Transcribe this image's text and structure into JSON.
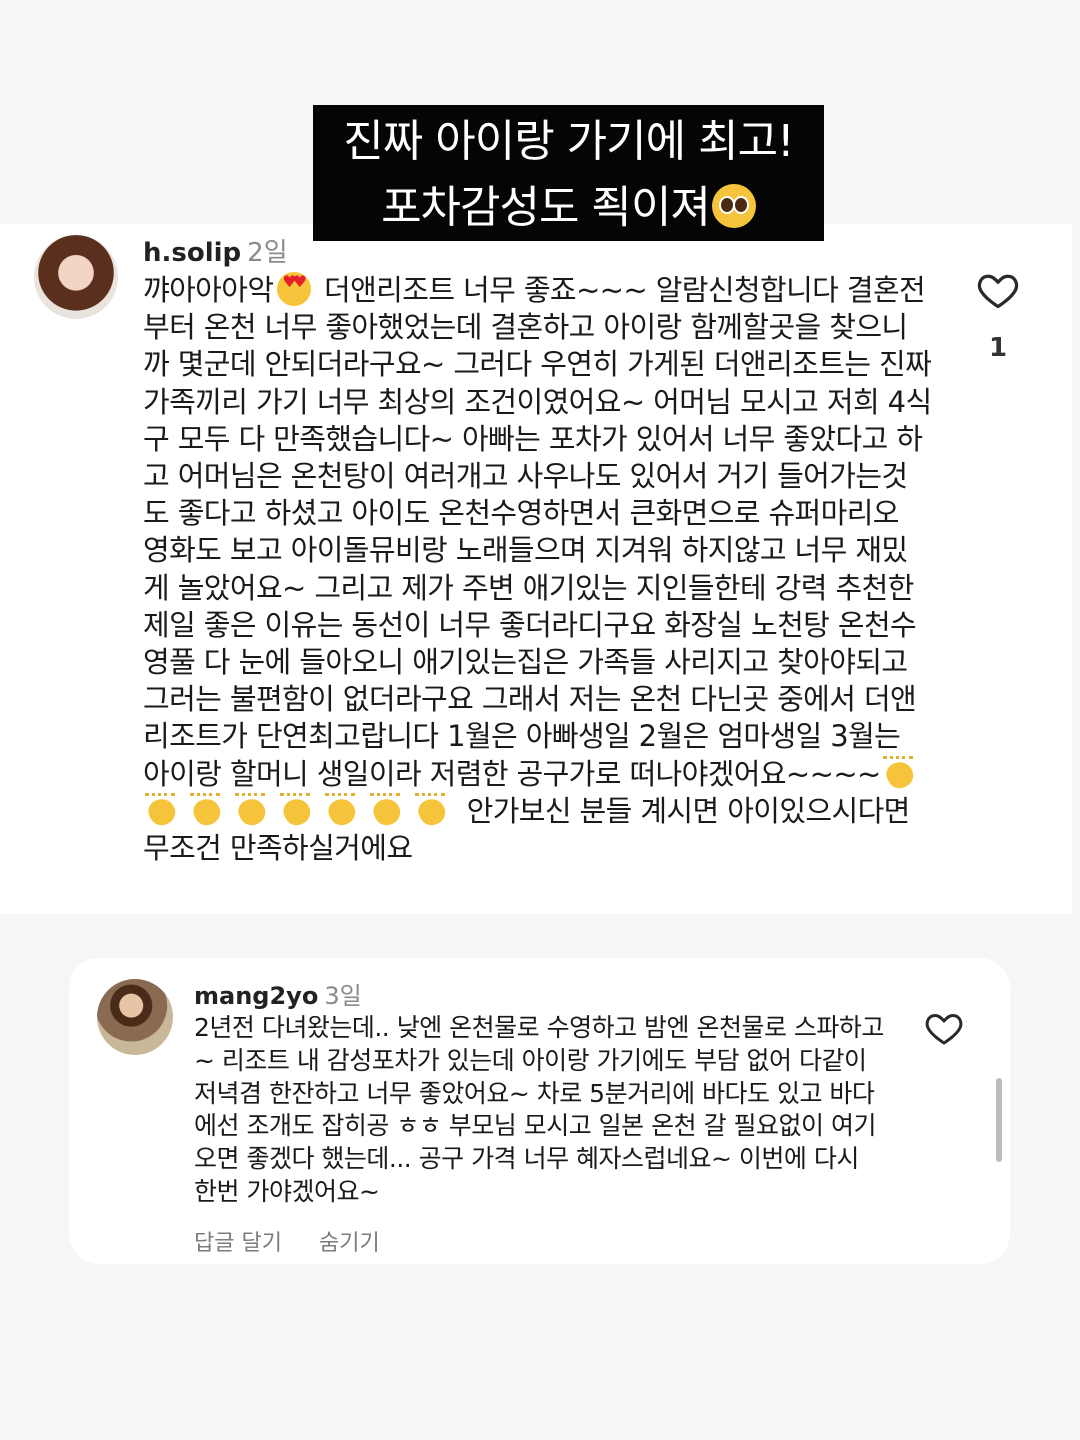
{
  "banner": {
    "line1": "진짜 아이랑 가기에 최고!",
    "line2": "포차감성도 죅이져",
    "emoji": "pleading-face"
  },
  "comment1": {
    "username": "h.solip",
    "age": "2일",
    "text_before_emoji": "꺄아아아악",
    "emoji": "smiling-face-with-heart-eyes",
    "text_main": " 더앤리조트 너무 좋죠~~~ 알람신청합니다 결혼전부터 온천 너무 좋아했었는데 결혼하고 아이랑 함께할곳을 찾으니까 몇군데 안되더라구요~ 그러다 우연히 가게된 더앤리조트는 진짜 가족끼리 가기 너무 최상의 조건이였어요~ 어머님 모시고 저희 4식구 모두 다 만족했습니다~ 아빠는 포차가 있어서 너무 좋았다고 하고 어머님은 온천탕이 여러개고 사우나도 있어서 거기 들어가는것도 좋다고 하셨고 아이도 온천수영하면서 큰화면으로 슈퍼마리오 영화도 보고 아이돌뮤비랑 노래들으며 지겨워 하지않고 너무 재밌게 놀았어요~ 그리고 제가 주변 애기있는 지인들한테 강력 추천한 제일 좋은 이유는 동선이 너무 좋더라디구요 화장실 노천탕 온천수영풀 다 눈에 들아오니 애기있는집은 가족들 사리지고 찾아야되고 그러는 불편함이 없더라구요 그래서 저는 온천 다닌곳 중에서 더앤리조트가 단연최고랍니다 1월은 아빠생일 2월은 엄마생일 3월는 아이랑 할머니 생일이라 저렴한 공구가로 떠나야겠어요~~~~",
    "clap_emoji": "clapping-hands",
    "text_end": " 안가보신 분들 계시면 아이있으시다면 무조건 만족하실거에요",
    "like_count": "1"
  },
  "comment2": {
    "username": "mang2yo",
    "age": "3일",
    "text": "2년전 다녀왔는데.. 낮엔 온천물로 수영하고 밤엔 온천물로 스파하고~ 리조트 내 감성포차가 있는데 아이랑 가기에도 부담 없어 다같이 저녁겸 한잔하고 너무 좋았어요~ 차로 5분거리에 바다도 있고 바다에선 조개도 잡히공 ㅎㅎ 부모님 모시고 일본 온천 갈 필요없이 여기 오면 좋겠다 했는데... 공구 가격 너무 혜자스럽네요~ 이번에 다시 한번 가야겠어요~",
    "reply_label": "답글 달기",
    "hide_label": "숨기기"
  }
}
